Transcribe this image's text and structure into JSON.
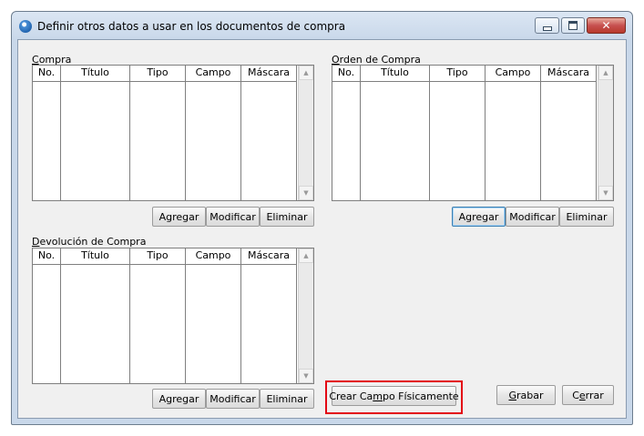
{
  "window": {
    "title": "Definir otros datos a usar en los documentos de compra",
    "controls": [
      "minimize-icon",
      "maximize-icon",
      "close-icon"
    ]
  },
  "columns": [
    "No.",
    "Título",
    "Tipo",
    "Campo",
    "Máscara"
  ],
  "groups": {
    "compra": {
      "label_first": "C",
      "label_rest": "ompra",
      "buttons": {
        "add": "Agregar",
        "modify": "Modificar",
        "delete": "Eliminar"
      }
    },
    "orden": {
      "label_first": "O",
      "label_rest": "rden de Compra",
      "buttons": {
        "add": "Agregar",
        "modify": "Modificar",
        "delete": "Eliminar"
      }
    },
    "devolucion": {
      "label_first": "D",
      "label_rest": "evolución de Compra",
      "buttons": {
        "add": "Agregar",
        "modify": "Modificar",
        "delete": "Eliminar"
      }
    }
  },
  "actions": {
    "create_field_pre": "Crear Ca",
    "create_field_mnemonic": "m",
    "create_field_post": "po Físicamente",
    "save_mnemonic": "G",
    "save_rest": "rabar",
    "close_pre": "C",
    "close_mnemonic": "e",
    "close_post": "rrar"
  },
  "colors": {
    "highlight": "#e30613",
    "titlebar": "#c9d8ea",
    "close_button": "#c75050"
  }
}
